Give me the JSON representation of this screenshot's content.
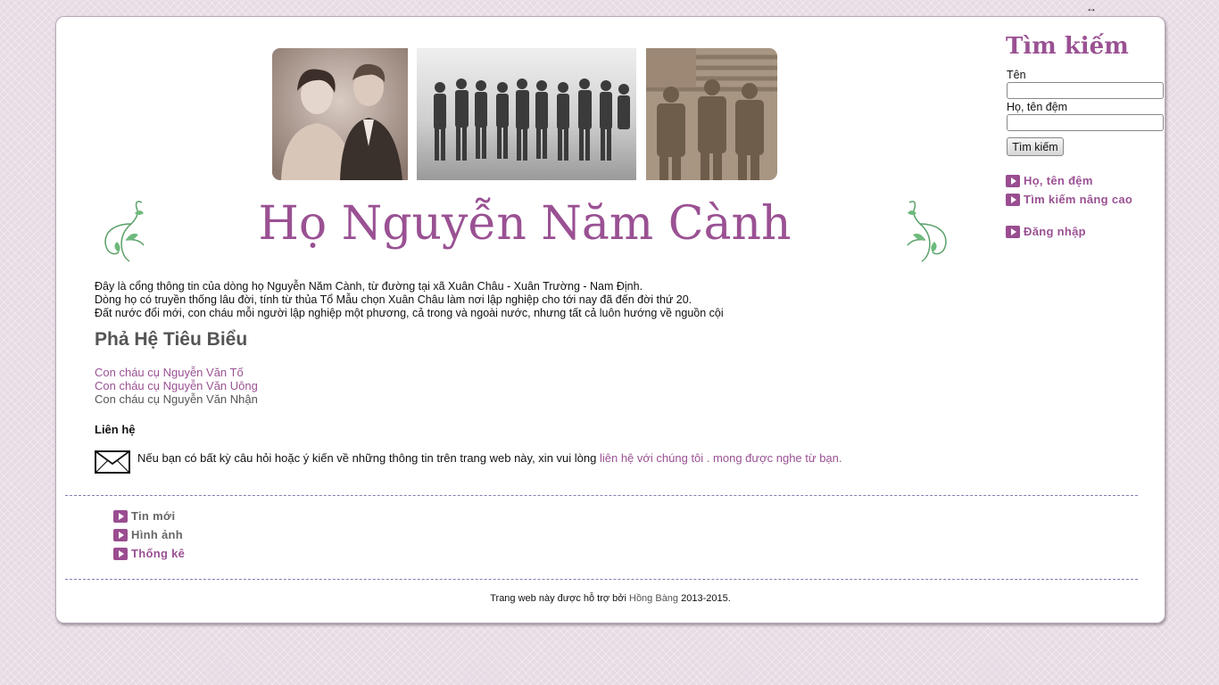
{
  "site": {
    "title": "Họ Nguyễn Năm Cành"
  },
  "intro": {
    "lines": [
      "Đây là cổng thông tin của dòng họ Nguyễn Năm Cành, từ đường tại xã Xuân Châu - Xuân Trường - Nam Định.",
      "Dòng họ có truyền thống lâu đời, tính từ thủa Tổ Mẫu chọn Xuân Châu làm nơi lập nghiệp cho tới nay đã đến đời thứ 20.",
      "Đất nước đổi mới, con cháu mỗi người lập nghiệp một phương, cả trong và ngoài nước, nhưng tất cả luôn hướng về nguồn cội"
    ]
  },
  "featured": {
    "heading": "Phả Hệ Tiêu Biểu",
    "links": [
      "Con cháu cụ Nguyễn Văn Tố",
      "Con cháu cụ Nguyễn Văn Uông"
    ],
    "plain": "Con cháu cụ Nguyễn Văn Nhận"
  },
  "contact": {
    "heading": "Liên hệ",
    "text": "Nếu bạn có bất kỳ câu hỏi hoặc ý kiến về những thông tin trên trang web này, xin vui lòng",
    "link": "liên hệ với chúng tôi",
    "suffix": ". mong được nghe từ bạn."
  },
  "footer_nav": [
    "Tin mới",
    "Hình ảnh",
    "Thống kê"
  ],
  "footer": {
    "prefix": "Trang web này được hỗ trợ bởi",
    "link": "Hồng Bàng",
    "suffix": "2013-2015."
  },
  "sidebar": {
    "search_title": "Tìm kiếm",
    "first_name_label": "Tên",
    "last_name_label": "Họ, tên đệm",
    "search_button": "Tìm kiếm",
    "links": [
      "Họ, tên đệm",
      "Tìm kiếm nâng cao"
    ],
    "login": "Đăng nhập"
  },
  "colors": {
    "accent": "#9a5193",
    "background": "#e7dbe5",
    "bullet": "#9a4d90",
    "divider": "#7f7fb0"
  },
  "icons": [
    "resize-horizontal-icon",
    "vine-ornament-icon",
    "envelope-icon",
    "arrow-bullet-icon"
  ]
}
